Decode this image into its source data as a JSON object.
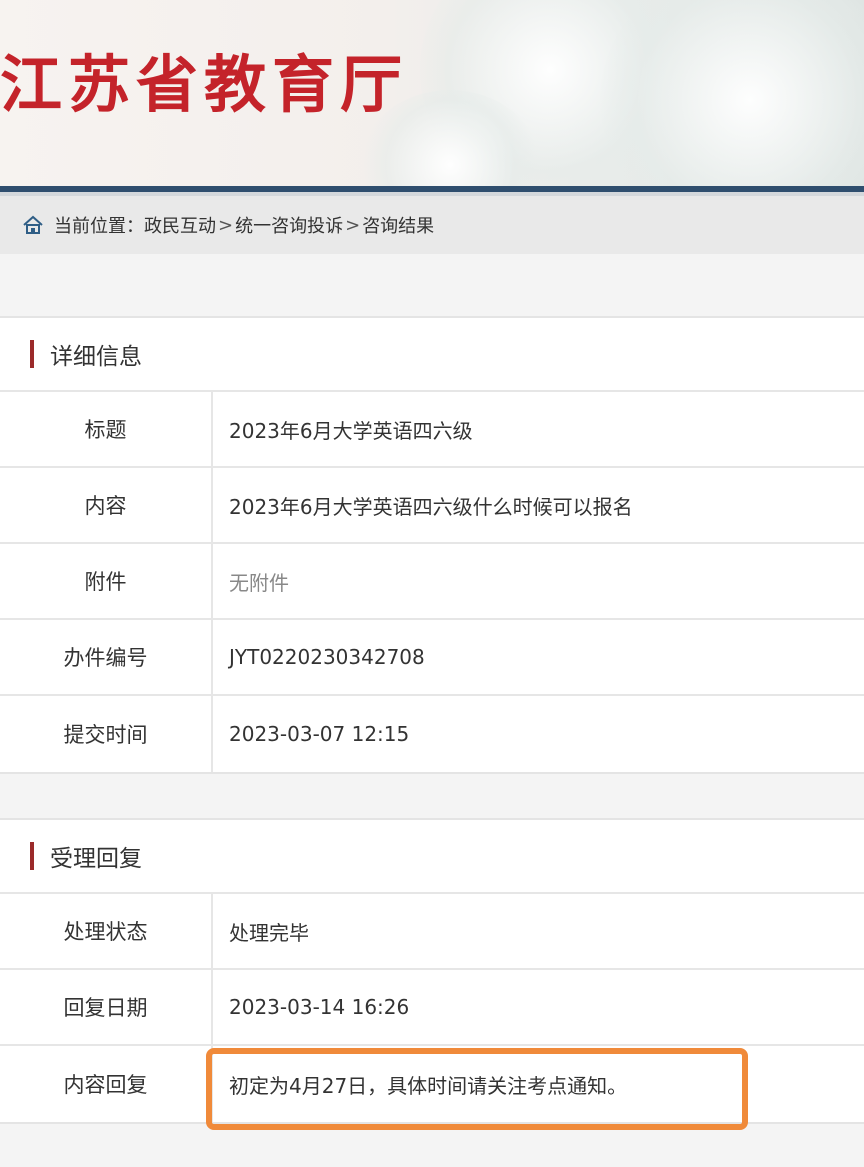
{
  "header": {
    "site_title": "江苏省教育厅"
  },
  "breadcrumb": {
    "prefix": "当前位置：",
    "items": [
      "政民互动",
      "统一咨询投诉",
      "咨询结果"
    ],
    "separator": ">"
  },
  "details": {
    "section_title": "详细信息",
    "rows": [
      {
        "label": "标题",
        "value": "2023年6月大学英语四六级"
      },
      {
        "label": "内容",
        "value": "2023年6月大学英语四六级什么时候可以报名"
      },
      {
        "label": "附件",
        "value": "无附件"
      },
      {
        "label": "办件编号",
        "value": "JYT0220230342708"
      },
      {
        "label": "提交时间",
        "value": "2023-03-07 12:15"
      }
    ]
  },
  "reply": {
    "section_title": "受理回复",
    "rows": [
      {
        "label": "处理状态",
        "value": "处理完毕"
      },
      {
        "label": "回复日期",
        "value": "2023-03-14 16:26"
      },
      {
        "label": "内容回复",
        "value": "初定为4月27日，具体时间请关注考点通知。"
      }
    ]
  },
  "colors": {
    "title_red": "#c4232a",
    "header_line": "#2f4e6e",
    "section_bar": "#9b2a2a",
    "highlight_orange": "#f08a3a"
  },
  "icons": {
    "breadcrumb": "home-icon"
  }
}
